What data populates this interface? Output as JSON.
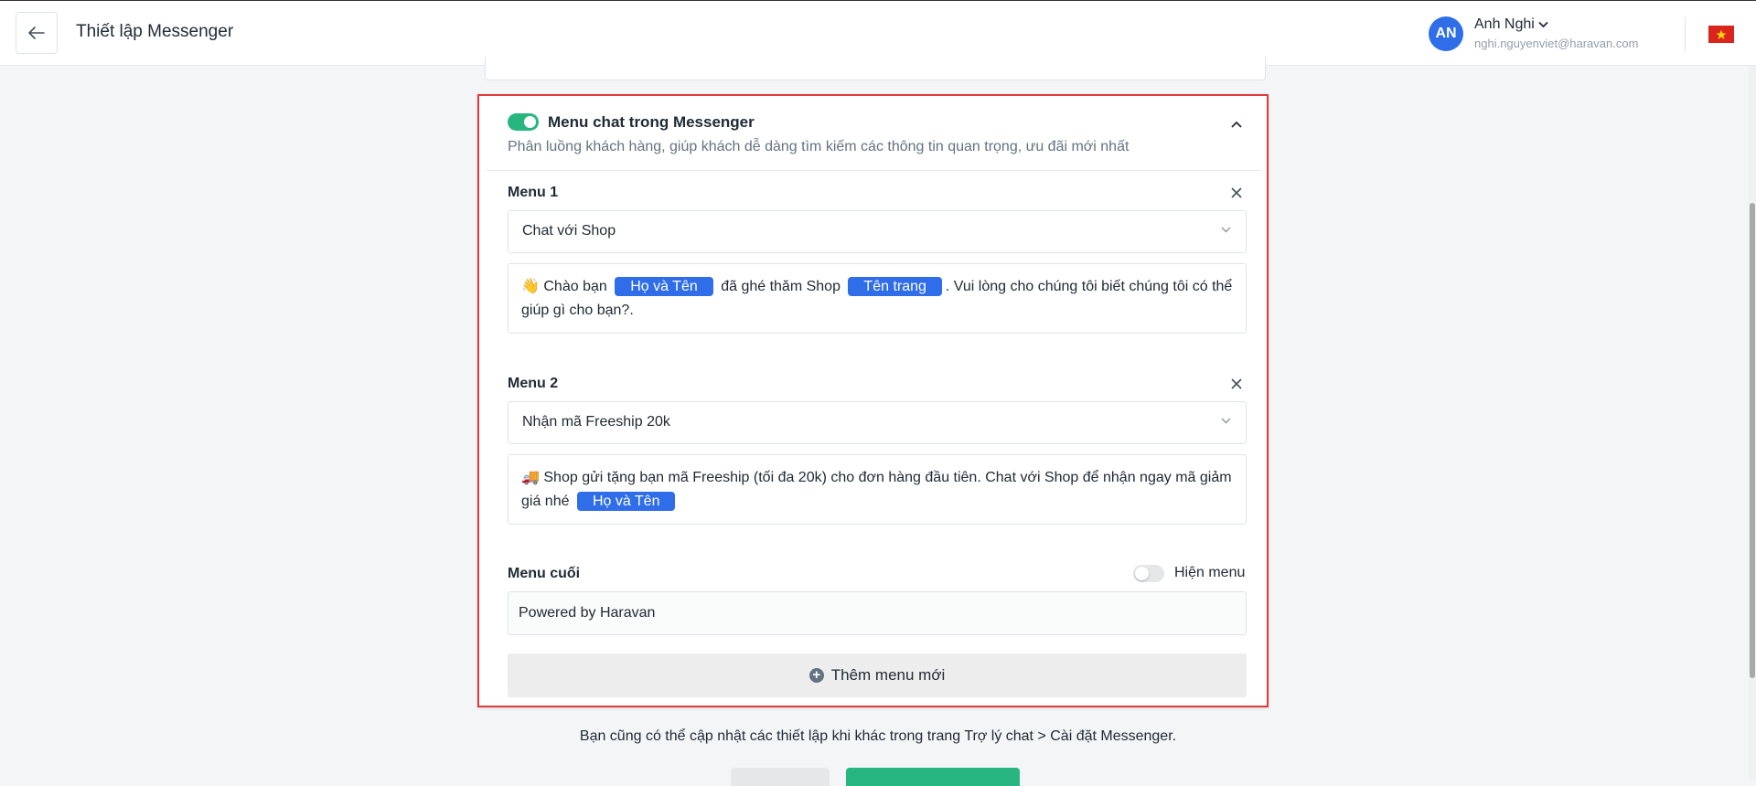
{
  "header": {
    "title": "Thiết lập Messenger",
    "user": {
      "initials": "AN",
      "name": "Anh Nghi",
      "email": "nghi.nguyenviet@haravan.com"
    }
  },
  "messenger_menu": {
    "enabled": true,
    "title": "Menu chat trong Messenger",
    "description": "Phân luồng khách hàng, giúp khách dễ dàng tìm kiếm các thông tin quan trọng, ưu đãi mới nhất",
    "menus": [
      {
        "label": "Menu 1",
        "selected": "Chat với Shop",
        "message": {
          "emoji": "👋",
          "part1": "Chào bạn",
          "tag1": "Họ và Tên",
          "part2": "đã ghé thăm Shop",
          "tag2": "Tên trang",
          "part3": ". Vui lòng cho chúng tôi biết chúng tôi có thể giúp gì cho bạn?."
        }
      },
      {
        "label": "Menu 2",
        "selected": "Nhận mã Freeship 20k",
        "message": {
          "emoji": "🚚",
          "part1": "Shop gửi tặng bạn mã Freeship (tối đa 20k) cho đơn hàng đầu tiên. Chat với Shop để nhận ngay mã giảm giá nhé",
          "tag1": "Họ và Tên"
        }
      }
    ],
    "footer_menu": {
      "label": "Menu cuối",
      "toggle_label": "Hiện menu",
      "toggle_on": false,
      "value": "Powered by Haravan"
    },
    "add_button": "Thêm menu mới"
  },
  "bottom_note": "Bạn cũng có thể cập nhật các thiết lập khi khác trong trang Trợ lý chat > Cài đặt Messenger.",
  "colors": {
    "accent_green": "#27b680",
    "tag_blue": "#2f6ee8",
    "highlight_red": "#e03a3a"
  }
}
